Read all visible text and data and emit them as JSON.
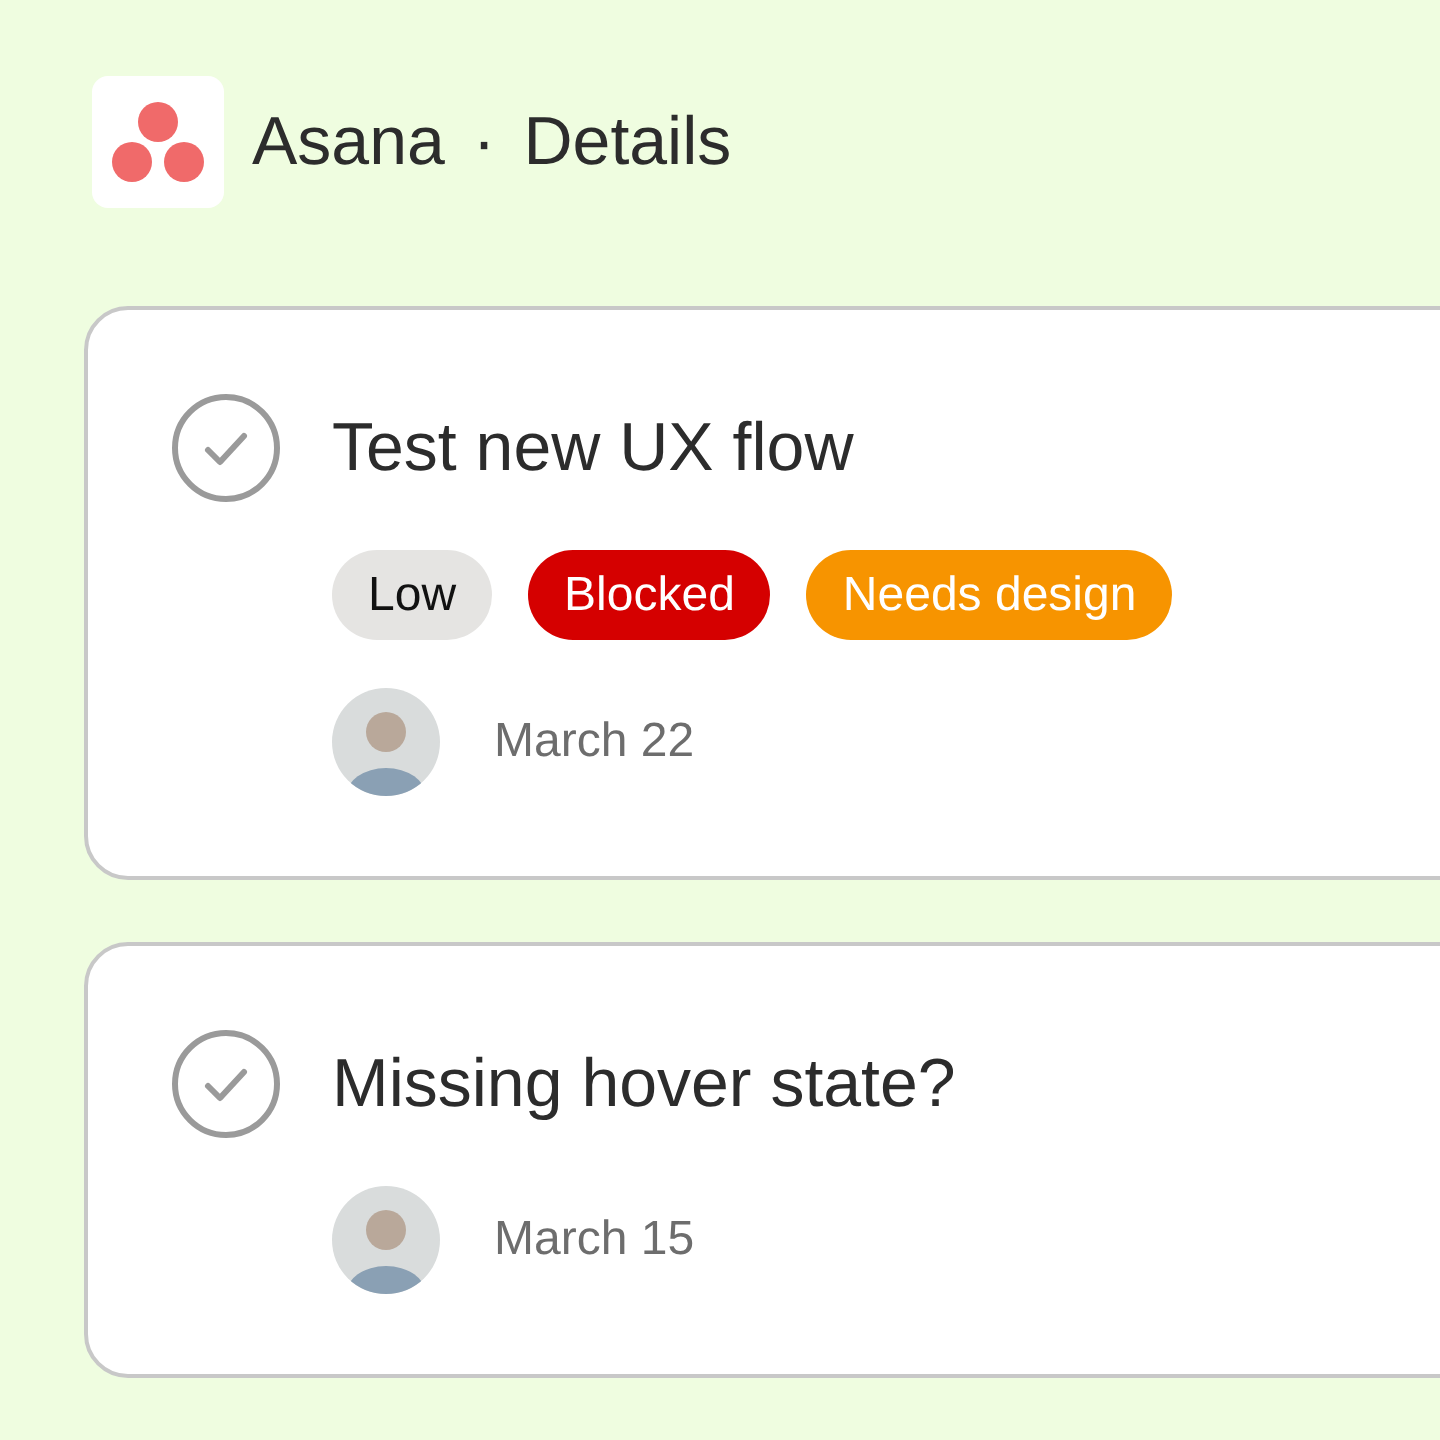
{
  "header": {
    "app": "Asana",
    "separator": "·",
    "page": "Details"
  },
  "tasks": [
    {
      "completed": false,
      "title": "Test new UX flow",
      "tags": [
        {
          "label": "Low",
          "color": "#e5e4e2"
        },
        {
          "label": "Blocked",
          "color": "#d50000"
        },
        {
          "label": "Needs design",
          "color": "#f79400"
        }
      ],
      "due": "March 22"
    },
    {
      "completed": false,
      "title": "Missing hover state?",
      "due": "March 15"
    }
  ]
}
